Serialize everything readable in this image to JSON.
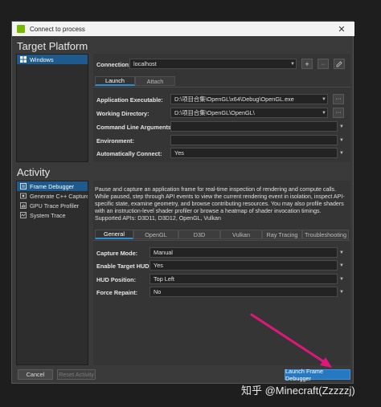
{
  "window": {
    "title": "Connect to process",
    "close_glyph": "✕"
  },
  "target_platform": {
    "heading": "Target Platform",
    "platforms": [
      {
        "label": "Windows",
        "icon": "windows-icon"
      }
    ],
    "connection": {
      "label": "Connection:",
      "value": "localhost"
    },
    "tabs": [
      {
        "label": "Launch",
        "active": true
      },
      {
        "label": "Attach",
        "active": false
      }
    ],
    "fields": [
      {
        "label": "Application Executable:",
        "value": "D:\\项目合集\\OpenGL\\x64\\Debug\\OpenGL.exe"
      },
      {
        "label": "Working Directory:",
        "value": "D:\\项目合集\\OpenGL\\OpenGL\\"
      },
      {
        "label": "Command Line Arguments:",
        "value": ""
      },
      {
        "label": "Environment:",
        "value": ""
      },
      {
        "label": "Automatically Connect:",
        "value": "Yes"
      }
    ],
    "browse_glyph": "···"
  },
  "activity": {
    "heading": "Activity",
    "items": [
      {
        "label": "Frame Debugger",
        "selected": true
      },
      {
        "label": "Generate C++ Capture",
        "selected": false
      },
      {
        "label": "GPU Trace Profiler",
        "selected": false
      },
      {
        "label": "System Trace",
        "selected": false
      }
    ],
    "description": "Pause and capture an application frame for real-time inspection of rendering and compute calls. While paused, step through API events to view the current rendering event in isolation, inspect API-specific state, examine geometry, and browse contributing resources. You may also profile shaders with an instruction-level shader profiler or browse a heatmap of shader invocation timings.",
    "supported": "Supported APIs: D3D11, D3D12, OpenGL, Vulkan",
    "tabs": [
      {
        "label": "General",
        "active": true
      },
      {
        "label": "OpenGL",
        "active": false
      },
      {
        "label": "D3D",
        "active": false
      },
      {
        "label": "Vulkan",
        "active": false
      },
      {
        "label": "Ray Tracing",
        "active": false
      },
      {
        "label": "Troubleshooting",
        "active": false
      }
    ],
    "options": [
      {
        "label": "Capture Mode:",
        "value": "Manual"
      },
      {
        "label": "Enable Target HUD:",
        "value": "Yes"
      },
      {
        "label": "HUD Position:",
        "value": "Top Left"
      },
      {
        "label": "Force Repaint:",
        "value": "No"
      }
    ]
  },
  "footer": {
    "cancel": "Cancel",
    "reset": "Reset Activity",
    "launch": "Launch Frame Debugger"
  },
  "watermark": "知乎 @Minecraft(Zzzzzj)",
  "colors": {
    "accent": "#2678c2",
    "arrow": "#e0177a",
    "selection": "#1e5a8c"
  }
}
